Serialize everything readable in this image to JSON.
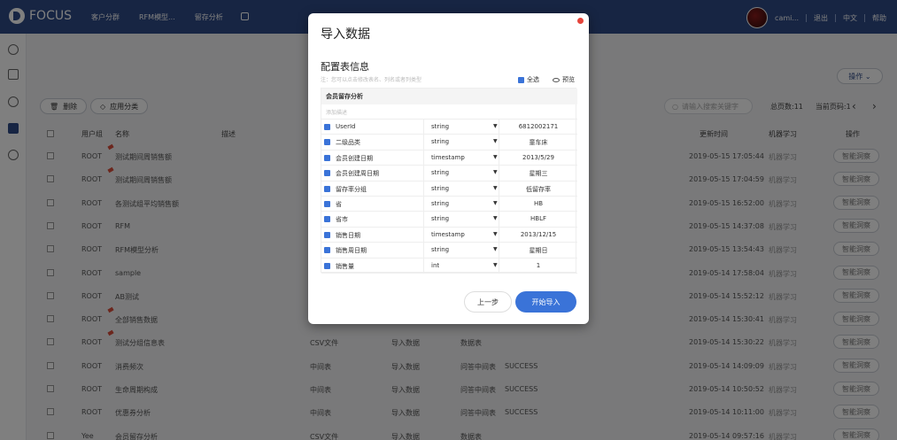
{
  "app": {
    "logo": "FOCUS"
  },
  "nav": {
    "items": [
      "客户分群",
      "RFM模型...",
      "留存分析"
    ]
  },
  "user": {
    "name": "cami...",
    "logout": "退出",
    "lang": "中文",
    "help": "帮助"
  },
  "toolbar": {
    "delete": "删除",
    "apply_category": "应用分类",
    "search_placeholder": "请输入搜索关键字",
    "total_pages": "总页数:11",
    "current_page": "当前页码:1",
    "ops": "操作"
  },
  "table": {
    "headers": {
      "user_group": "用户组",
      "name": "名称",
      "desc": "描述",
      "updated": "更新时间",
      "ml": "机器学习",
      "op": "操作"
    },
    "rows": [
      {
        "group": "ROOT",
        "name": "测试期间周销售额",
        "type": "",
        "source": "",
        "kind": "",
        "status": "",
        "time": "2019-05-15 17:05:44",
        "ml": "机器学习",
        "btn": "智能洞察",
        "pin": true
      },
      {
        "group": "ROOT",
        "name": "测试期间周销售额",
        "type": "",
        "source": "",
        "kind": "",
        "status": "",
        "time": "2019-05-15 17:04:59",
        "ml": "机器学习",
        "btn": "智能洞察",
        "pin": true
      },
      {
        "group": "ROOT",
        "name": "各测试组平均销售额",
        "type": "",
        "source": "",
        "kind": "",
        "status": "",
        "time": "2019-05-15 16:52:00",
        "ml": "机器学习",
        "btn": "智能洞察",
        "pin": false
      },
      {
        "group": "ROOT",
        "name": "RFM",
        "type": "",
        "source": "",
        "kind": "",
        "status": "",
        "time": "2019-05-15 14:37:08",
        "ml": "机器学习",
        "btn": "智能洞察",
        "pin": false
      },
      {
        "group": "ROOT",
        "name": "RFM模型分析",
        "type": "",
        "source": "",
        "kind": "",
        "status": "",
        "time": "2019-05-15 13:54:43",
        "ml": "机器学习",
        "btn": "智能洞察",
        "pin": false
      },
      {
        "group": "ROOT",
        "name": "sample",
        "type": "",
        "source": "",
        "kind": "",
        "status": "",
        "time": "2019-05-14 17:58:04",
        "ml": "机器学习",
        "btn": "智能洞察",
        "pin": false
      },
      {
        "group": "ROOT",
        "name": "AB测试",
        "type": "",
        "source": "",
        "kind": "",
        "status": "",
        "time": "2019-05-14 15:52:12",
        "ml": "机器学习",
        "btn": "智能洞察",
        "pin": false
      },
      {
        "group": "ROOT",
        "name": "全部销售数据",
        "type": "",
        "source": "",
        "kind": "",
        "status": "",
        "time": "2019-05-14 15:30:41",
        "ml": "机器学习",
        "btn": "智能洞察",
        "pin": true
      },
      {
        "group": "ROOT",
        "name": "测试分组信息表",
        "type": "CSV文件",
        "source": "导入数据",
        "kind": "数据表",
        "status": "",
        "time": "2019-05-14 15:30:22",
        "ml": "机器学习",
        "btn": "智能洞察",
        "pin": true
      },
      {
        "group": "ROOT",
        "name": "消费频次",
        "type": "中间表",
        "source": "导入数据",
        "kind": "问答中间表",
        "status": "SUCCESS",
        "time": "2019-05-14 14:09:09",
        "ml": "机器学习",
        "btn": "智能洞察",
        "pin": false
      },
      {
        "group": "ROOT",
        "name": "生命周期构成",
        "type": "中间表",
        "source": "导入数据",
        "kind": "问答中间表",
        "status": "SUCCESS",
        "time": "2019-05-14 10:50:52",
        "ml": "机器学习",
        "btn": "智能洞察",
        "pin": false
      },
      {
        "group": "ROOT",
        "name": "优惠券分析",
        "type": "中间表",
        "source": "导入数据",
        "kind": "问答中间表",
        "status": "SUCCESS",
        "time": "2019-05-14 10:11:00",
        "ml": "机器学习",
        "btn": "智能洞察",
        "pin": false
      },
      {
        "group": "Yee",
        "name": "会员留存分析",
        "type": "CSV文件",
        "source": "导入数据",
        "kind": "数据表",
        "status": "",
        "time": "2019-05-14 09:57:16",
        "ml": "机器学习",
        "btn": "智能洞察",
        "pin": false
      }
    ]
  },
  "modal": {
    "title": "导入数据",
    "subtitle": "配置表信息",
    "note": "注：您可以点击修改表名、列名或者列类型",
    "select_all": "全选",
    "preview": "预览",
    "table_name": "会员留存分析",
    "desc_placeholder": "添加描述",
    "fields": [
      {
        "name": "UserId",
        "type": "string",
        "value": "6812002171"
      },
      {
        "name": "二级品类",
        "type": "string",
        "value": "童车床"
      },
      {
        "name": "会员创建日期",
        "type": "timestamp",
        "value": "2013/5/29"
      },
      {
        "name": "会员创建周日期",
        "type": "string",
        "value": "星期三"
      },
      {
        "name": "留存率分组",
        "type": "string",
        "value": "低留存率"
      },
      {
        "name": "省",
        "type": "string",
        "value": "HB"
      },
      {
        "name": "省市",
        "type": "string",
        "value": "HBLF"
      },
      {
        "name": "销售日期",
        "type": "timestamp",
        "value": "2013/12/15"
      },
      {
        "name": "销售周日期",
        "type": "string",
        "value": "星期日"
      },
      {
        "name": "销售量",
        "type": "int",
        "value": "1"
      }
    ],
    "prev_btn": "上一步",
    "start_btn": "开始导入"
  }
}
